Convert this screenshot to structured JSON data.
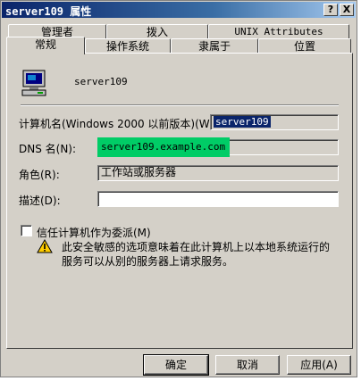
{
  "window": {
    "title": "server109 属性",
    "help_button": "?",
    "close_button": "X"
  },
  "tabs": {
    "row1": [
      "管理者",
      "拨入",
      "UNIX Attributes"
    ],
    "row2": [
      "常规",
      "操作系统",
      "隶属于",
      "位置"
    ],
    "active": "常规"
  },
  "general": {
    "computer_name": "server109",
    "netbios_label": "计算机名(Windows 2000 以前版本)(W):",
    "netbios_value": "server109",
    "dns_label": "DNS 名(N):",
    "dns_value": "server109.example.com",
    "role_label": "角色(R):",
    "role_value": "工作站或服务器",
    "description_label": "描述(D):",
    "description_value": "",
    "trust_label": "信任计算机作为委派(M)",
    "trust_checked": false,
    "warning_line1": "此安全敏感的选项意味着在此计算机上以本地系统运行的",
    "warning_line2": "服务可以从别的服务器上请求服务。"
  },
  "buttons": {
    "ok": "确定",
    "cancel": "取消",
    "apply": "应用(A)"
  },
  "colors": {
    "title_bar": "#0a246a",
    "selection": "#0a246a",
    "highlight_annotation": "#00cc66",
    "warning": "#ffcc00"
  },
  "icons": {
    "computer": "computer-icon",
    "warning": "warning-icon"
  }
}
